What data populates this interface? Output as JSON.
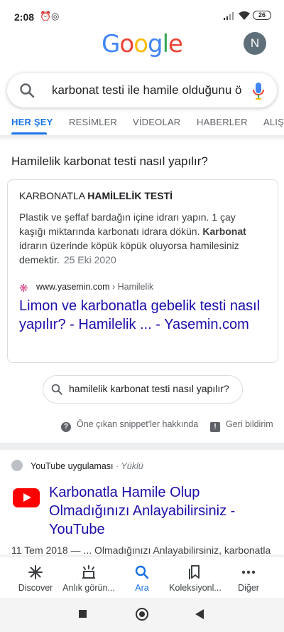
{
  "status_bar": {
    "time": "2:08",
    "battery": "26"
  },
  "header": {
    "logo_letters": [
      {
        "ch": "G",
        "color": "#4285F4"
      },
      {
        "ch": "o",
        "color": "#EA4335"
      },
      {
        "ch": "o",
        "color": "#FBBC05"
      },
      {
        "ch": "g",
        "color": "#4285F4"
      },
      {
        "ch": "l",
        "color": "#34A853"
      },
      {
        "ch": "e",
        "color": "#EA4335"
      }
    ],
    "avatar_initial": "N"
  },
  "search": {
    "query": "karbonat testi ile hamile olduğunu ö"
  },
  "tabs": [
    {
      "label": "HER ŞEY",
      "active": true
    },
    {
      "label": "RESİMLER",
      "active": false
    },
    {
      "label": "VİDEOLAR",
      "active": false
    },
    {
      "label": "HABERLER",
      "active": false
    },
    {
      "label": "ALIŞ",
      "active": false
    }
  ],
  "featured": {
    "question": "Hamilelik karbonat testi nasıl yapılır?",
    "heading_normal": "KARBONATLA ",
    "heading_bold": "HAMİLELİK TESTİ",
    "body_part1": "Plastik ve şeffaf bardağın içine idrarı yapın. 1 çay kaşığı miktarında karbonatı idrara dökün. ",
    "body_bold": "Karbonat",
    "body_part2": " idrarın üzerinde köpük köpük oluyorsa hamilesiniz demektir.",
    "date": "25 Eki 2020",
    "source_domain": "www.yasemin.com",
    "source_crumb": " › Hamilelik",
    "link_title": "Limon ve karbonatla gebelik testi nasıl yapılır? - Hamilelik ... - Yasemin.com",
    "related_query": "hamilelik karbonat testi nasıl yapılır?",
    "about_label": "Öne çıkan snippet'ler hakkında",
    "feedback_label": "Geri bildirim"
  },
  "result2": {
    "source": "YouTube uygulaması",
    "source_note": " · Yüklü",
    "title": "Karbonatla Hamile Olup Olmadığınızı Anlayabilirsiniz - YouTube",
    "snippet": "11 Tem 2018 — ... Olmadığınızı Anlayabilirsiniz, karbonatla"
  },
  "bottom_nav": [
    {
      "label": "Discover",
      "icon": "asterisk-icon",
      "active": false
    },
    {
      "label": "Anlık görün...",
      "icon": "snapshot-icon",
      "active": false
    },
    {
      "label": "Ara",
      "icon": "search-icon",
      "active": true
    },
    {
      "label": "Koleksiyonl...",
      "icon": "bookmarks-icon",
      "active": false
    },
    {
      "label": "Diğer",
      "icon": "more-icon",
      "active": false
    }
  ]
}
